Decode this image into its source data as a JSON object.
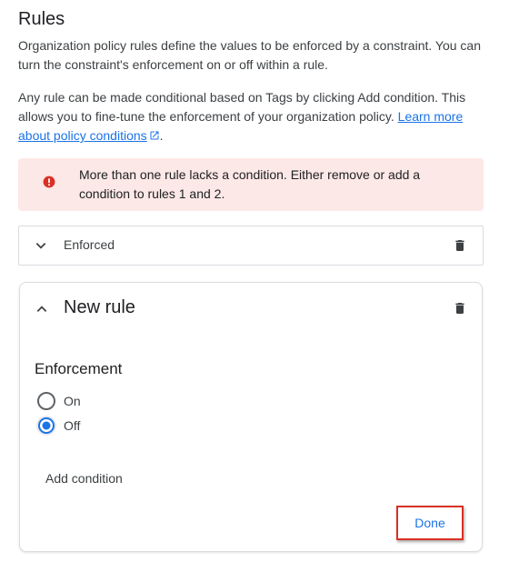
{
  "heading": "Rules",
  "intro": {
    "p1": "Organization policy rules define the values to be enforced by a constraint. You can turn the constraint's enforcement on or off within a rule.",
    "p2_text": "Any rule can be made conditional based on Tags by clicking Add condition. This allows you to fine-tune the enforcement of your organization policy.",
    "p2_link": "Learn more about policy conditions",
    "p2_end": "."
  },
  "alert": {
    "message": "More than one rule lacks a condition. Either remove or add a condition to rules 1 and 2.",
    "icon": "error-icon",
    "color": "#d93025",
    "background": "#fce8e6"
  },
  "rules": [
    {
      "label": "Enforced",
      "expanded": false
    },
    {
      "label": "New rule",
      "expanded": true
    }
  ],
  "new_rule": {
    "section_title": "Enforcement",
    "options": [
      {
        "label": "On",
        "selected": false
      },
      {
        "label": "Off",
        "selected": true
      }
    ],
    "add_condition_label": "Add condition",
    "done_label": "Done"
  },
  "colors": {
    "accent": "#1a73e8",
    "highlight": "#d93025"
  }
}
